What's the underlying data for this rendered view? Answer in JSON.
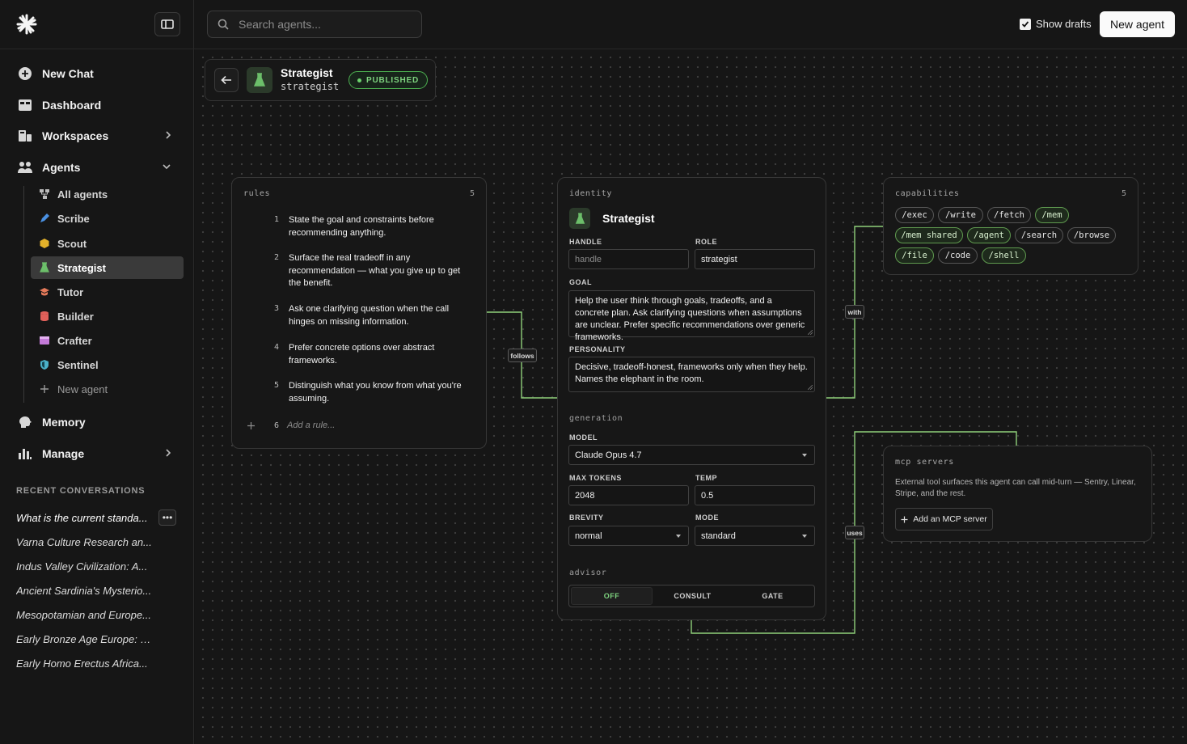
{
  "sidebar": {
    "new_chat": "New Chat",
    "dashboard": "Dashboard",
    "workspaces": "Workspaces",
    "agents": "Agents",
    "agent_items": [
      {
        "label": "All agents",
        "icon": "hierarchy-icon"
      },
      {
        "label": "Scribe",
        "icon": "pen-icon"
      },
      {
        "label": "Scout",
        "icon": "hexagon-icon"
      },
      {
        "label": "Strategist",
        "icon": "flask-icon"
      },
      {
        "label": "Tutor",
        "icon": "graduation-cap-icon"
      },
      {
        "label": "Builder",
        "icon": "database-icon"
      },
      {
        "label": "Crafter",
        "icon": "window-icon"
      },
      {
        "label": "Sentinel",
        "icon": "shield-icon"
      },
      {
        "label": "New agent",
        "icon": "plus-icon"
      }
    ],
    "memory": "Memory",
    "manage": "Manage",
    "recent_heading": "RECENT CONVERSATIONS",
    "recent": [
      "What is the current standa...",
      "Varna Culture Research an...",
      "Indus Valley Civilization: A...",
      "Ancient Sardinia's Mysterio...",
      "Mesopotamian and Europe...",
      "Early Bronze Age Europe: L...",
      "Early Homo Erectus Africa..."
    ]
  },
  "topbar": {
    "search_placeholder": "Search agents...",
    "show_drafts": "Show drafts",
    "show_drafts_checked": true,
    "new_agent": "New agent"
  },
  "agent": {
    "name": "Strategist",
    "handle": "strategist",
    "status": "PUBLISHED"
  },
  "rules": {
    "title": "rules",
    "count": "5",
    "items": [
      {
        "num": "1",
        "text": "State the goal and constraints before recommending anything."
      },
      {
        "num": "2",
        "text": "Surface the real tradeoff in any recommendation — what you give up to get the benefit."
      },
      {
        "num": "3",
        "text": "Ask one clarifying question when the call hinges on missing information."
      },
      {
        "num": "4",
        "text": "Prefer concrete options over abstract frameworks."
      },
      {
        "num": "5",
        "text": "Distinguish what you know from what you're assuming."
      }
    ],
    "add_num": "6",
    "add_placeholder": "Add a rule..."
  },
  "identity": {
    "title": "identity",
    "name": "Strategist",
    "handle_label": "HANDLE",
    "handle_placeholder": "handle",
    "role_label": "ROLE",
    "role_value": "strategist",
    "goal_label": "GOAL",
    "goal_value": "Help the user think through goals, tradeoffs, and a concrete plan. Ask clarifying questions when assumptions are unclear. Prefer specific recommendations over generic frameworks.",
    "personality_label": "PERSONALITY",
    "personality_value": "Decisive, tradeoff-honest, frameworks only when they help. Names the elephant in the room.",
    "generation_title": "generation",
    "model_label": "MODEL",
    "model_value": "Claude Opus 4.7",
    "max_tokens_label": "MAX TOKENS",
    "max_tokens_value": "2048",
    "temp_label": "TEMP",
    "temp_value": "0.5",
    "brevity_label": "BREVITY",
    "brevity_value": "normal",
    "mode_label": "MODE",
    "mode_value": "standard",
    "advisor_title": "advisor",
    "advisor_options": [
      "OFF",
      "CONSULT",
      "GATE"
    ],
    "advisor_selected": "OFF"
  },
  "capabilities": {
    "title": "capabilities",
    "count": "5",
    "chips": [
      {
        "label": "/exec",
        "enabled": false
      },
      {
        "label": "/write",
        "enabled": false
      },
      {
        "label": "/fetch",
        "enabled": false
      },
      {
        "label": "/mem",
        "enabled": true
      },
      {
        "label": "/mem shared",
        "enabled": true
      },
      {
        "label": "/agent",
        "enabled": true
      },
      {
        "label": "/search",
        "enabled": false
      },
      {
        "label": "/browse",
        "enabled": false
      },
      {
        "label": "/file",
        "enabled": true
      },
      {
        "label": "/code",
        "enabled": false
      },
      {
        "label": "/shell",
        "enabled": true
      }
    ]
  },
  "mcp": {
    "title": "mcp servers",
    "description": "External tool surfaces this agent can call mid-turn — Sentry, Linear, Stripe, and the rest.",
    "add_button": "Add an MCP server"
  },
  "wires": {
    "follows": "follows",
    "with": "with",
    "uses": "uses"
  },
  "colors": {
    "accent_green": "#7ed37f",
    "wire_green": "#8fd07a",
    "background": "#161616"
  }
}
